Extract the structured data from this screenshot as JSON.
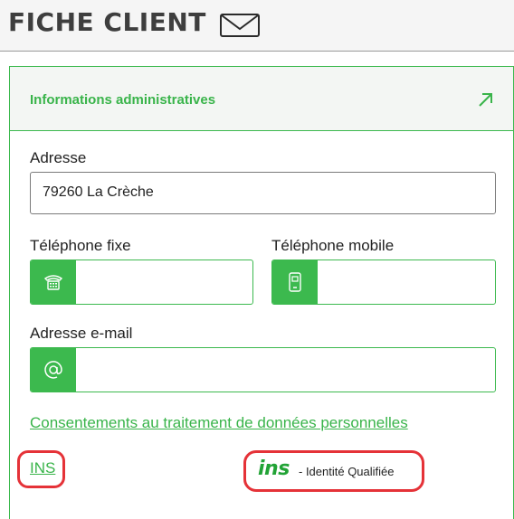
{
  "header": {
    "title": "FICHE CLIENT"
  },
  "card": {
    "title": "Informations administratives",
    "address": {
      "label": "Adresse",
      "value": "79260 La Crèche"
    },
    "phone_fixed": {
      "label": "Téléphone fixe",
      "value": ""
    },
    "phone_mobile": {
      "label": "Téléphone mobile",
      "value": ""
    },
    "email": {
      "label": "Adresse e-mail",
      "value": ""
    },
    "consent_link": "Consentements au traitement de données personnelles",
    "ins_link": "INS",
    "ins_badge": {
      "logo": "ins",
      "text": "- Identité Qualifiée"
    }
  },
  "icons": [
    "envelope-icon",
    "arrow-up-right-icon",
    "phone-icon",
    "mobile-phone-icon",
    "at-icon"
  ],
  "colors": {
    "accent": "#3cb94e",
    "highlight": "#e53238",
    "title": "#3e3e3e"
  }
}
